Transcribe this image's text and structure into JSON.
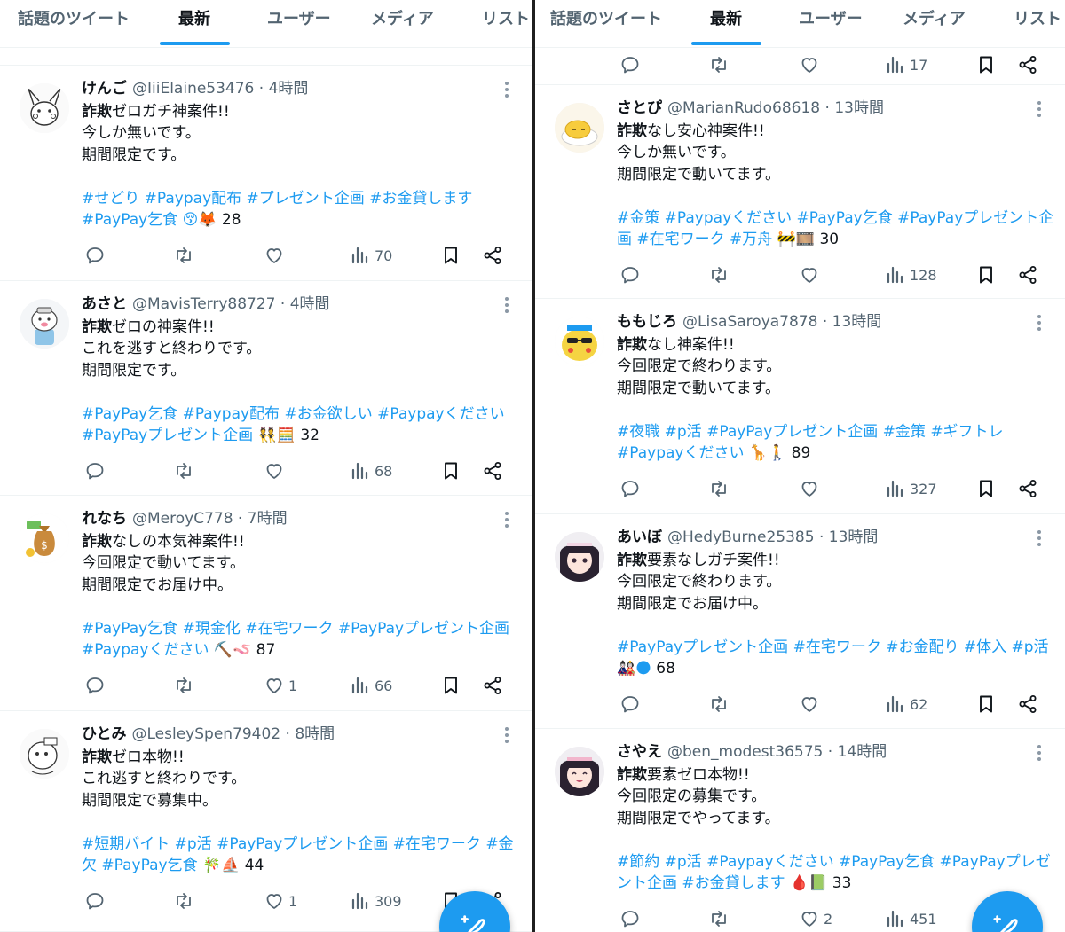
{
  "left": {
    "tabs": [
      {
        "label": "話題のツイート",
        "active": false
      },
      {
        "label": "最新",
        "active": true
      },
      {
        "label": "ユーザー",
        "active": false
      },
      {
        "label": "メディア",
        "active": false
      },
      {
        "label": "リスト",
        "active": false
      }
    ],
    "tweets": [
      {
        "name": "けんご",
        "handle": "@IiiElaine53476",
        "time": "4時間",
        "lines": [
          [
            "詐欺",
            "ゼロガチ神案件!!"
          ],
          [
            "",
            "今しか無いです。"
          ],
          [
            "",
            "期間限定です。"
          ]
        ],
        "tags": [
          "#せどり #Paypay配布 #プレゼント企画 #お金貸します",
          "#PayPay乞食 😚🦊"
        ],
        "tag_count": "28",
        "reply": "",
        "retweet": "",
        "like": "",
        "views": "70"
      },
      {
        "name": "あさと",
        "handle": "@MavisTerry88727",
        "time": "4時間",
        "lines": [
          [
            "詐欺",
            "ゼロの神案件!!"
          ],
          [
            "",
            "これを逃すと終わりです。"
          ],
          [
            "",
            "期間限定です。"
          ]
        ],
        "tags": [
          "#PayPay乞食 #Paypay配布 #お金欲しい #Paypayください",
          "#PayPayプレゼント企画 👯🧮"
        ],
        "tag_count": "32",
        "reply": "",
        "retweet": "",
        "like": "",
        "views": "68"
      },
      {
        "name": "れなち",
        "handle": "@MeroyC778",
        "time": "7時間",
        "lines": [
          [
            "詐欺",
            "なしの本気神案件!!"
          ],
          [
            "",
            "今回限定で動いてます。"
          ],
          [
            "",
            "期間限定でお届け中。"
          ]
        ],
        "tags": [
          "#PayPay乞食 #現金化 #在宅ワーク #PayPayプレゼント企画",
          "#Paypayください ⛏️🪱"
        ],
        "tag_count": "87",
        "reply": "",
        "retweet": "",
        "like": "1",
        "views": "66"
      },
      {
        "name": "ひとみ",
        "handle": "@LesleySpen79402",
        "time": "8時間",
        "lines": [
          [
            "詐欺",
            "ゼロ本物!!"
          ],
          [
            "",
            "これ逃すと終わりです。"
          ],
          [
            "",
            "期間限定で募集中。"
          ]
        ],
        "tags": [
          "#短期バイト #p活 #PayPayプレゼント企画 #在宅ワーク #金",
          "欠 #PayPay乞食 🎋⛵"
        ],
        "tag_count": "44",
        "reply": "",
        "retweet": "",
        "like": "1",
        "views": "309"
      }
    ]
  },
  "right": {
    "tabs": [
      {
        "label": "話題のツイート",
        "active": false
      },
      {
        "label": "最新",
        "active": true
      },
      {
        "label": "ユーザー",
        "active": false
      },
      {
        "label": "メディア",
        "active": false
      },
      {
        "label": "リスト",
        "active": false
      }
    ],
    "partial_views": "17",
    "tweets": [
      {
        "name": "さとぴ",
        "handle": "@MarianRudo68618",
        "time": "13時間",
        "lines": [
          [
            "詐欺",
            "なし安心神案件!!"
          ],
          [
            "",
            "今しか無いです。"
          ],
          [
            "",
            "期間限定で動いてます。"
          ]
        ],
        "tags": [
          "#金策 #Paypayください #PayPay乞食 #PayPayプレゼント企",
          "画 #在宅ワーク #万舟 🚧🎞️"
        ],
        "tag_count": "30",
        "reply": "",
        "retweet": "",
        "like": "",
        "views": "128"
      },
      {
        "name": "ももじろ",
        "handle": "@LisaSaroya7878",
        "time": "13時間",
        "lines": [
          [
            "詐欺",
            "なし神案件!!"
          ],
          [
            "",
            "今回限定で終わります。"
          ],
          [
            "",
            "期間限定で動いてます。"
          ]
        ],
        "tags": [
          "#夜職 #p活 #PayPayプレゼント企画 #金策 #ギフトレ",
          "#Paypayください 🦒🚶"
        ],
        "tag_count": "89",
        "reply": "",
        "retweet": "",
        "like": "",
        "views": "327"
      },
      {
        "name": "あいぼ",
        "handle": "@HedyBurne25385",
        "time": "13時間",
        "lines": [
          [
            "詐欺",
            "要素なしガチ案件!!"
          ],
          [
            "",
            "今回限定で終わります。"
          ],
          [
            "",
            "期間限定でお届け中。"
          ]
        ],
        "tags": [
          "#PayPayプレゼント企画 #在宅ワーク #お金配り #体入 #p活",
          "🎎🌑"
        ],
        "tag_count": "68",
        "reply": "",
        "retweet": "",
        "like": "",
        "views": "62"
      },
      {
        "name": "さやえ",
        "handle": "@ben_modest36575",
        "time": "14時間",
        "lines": [
          [
            "詐欺",
            "要素ゼロ本物!!"
          ],
          [
            "",
            "今回限定の募集です。"
          ],
          [
            "",
            "期間限定でやってます。"
          ]
        ],
        "tags": [
          "#節約 #p活 #Paypayください #PayPay乞食 #PayPayプレゼ",
          "ント企画 #お金貸します 🩸📗"
        ],
        "tag_count": "33",
        "reply": "",
        "retweet": "",
        "like": "2",
        "views": "451"
      }
    ]
  },
  "icons": {
    "reply": "reply-icon",
    "retweet": "retweet-icon",
    "like": "like-icon",
    "views": "views-icon",
    "bookmark": "bookmark-icon",
    "share": "share-icon",
    "more": "more-icon",
    "compose": "compose-icon"
  },
  "colors": {
    "accent": "#1d9bf0",
    "muted": "#536471",
    "text": "#0f1419",
    "border": "#eff3f4"
  }
}
